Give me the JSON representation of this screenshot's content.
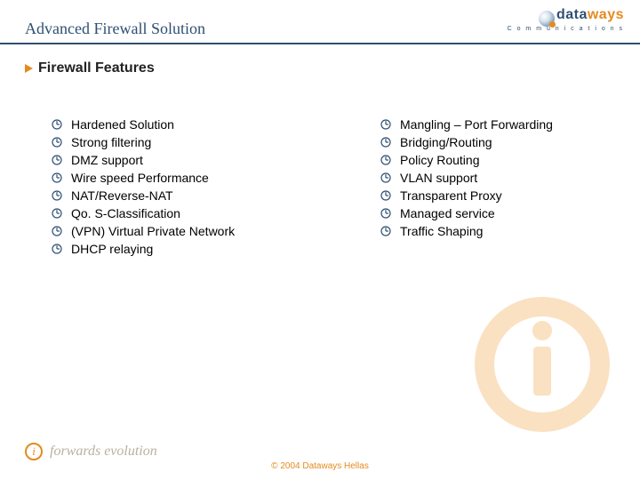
{
  "header": {
    "title": "Advanced Firewall Solution",
    "brand_data": "data",
    "brand_ways": "ways",
    "brand_sub": "C o m m u n i c a t i o n s"
  },
  "section": {
    "title": "Firewall Features"
  },
  "features": {
    "left": [
      "Hardened Solution",
      "Strong filtering",
      "DMZ support",
      "Wire speed Performance",
      "NAT/Reverse-NAT",
      "Qo. S-Classification",
      "(VPN) Virtual Private Network",
      "DHCP relaying"
    ],
    "right": [
      "Mangling – Port Forwarding",
      "Bridging/Routing",
      "Policy Routing",
      "VLAN support",
      "Transparent Proxy",
      "Managed service",
      "Traffic Shaping"
    ]
  },
  "footer": {
    "tagline": "forwards evolution",
    "copyright": "© 2004 Dataways Hellas"
  }
}
